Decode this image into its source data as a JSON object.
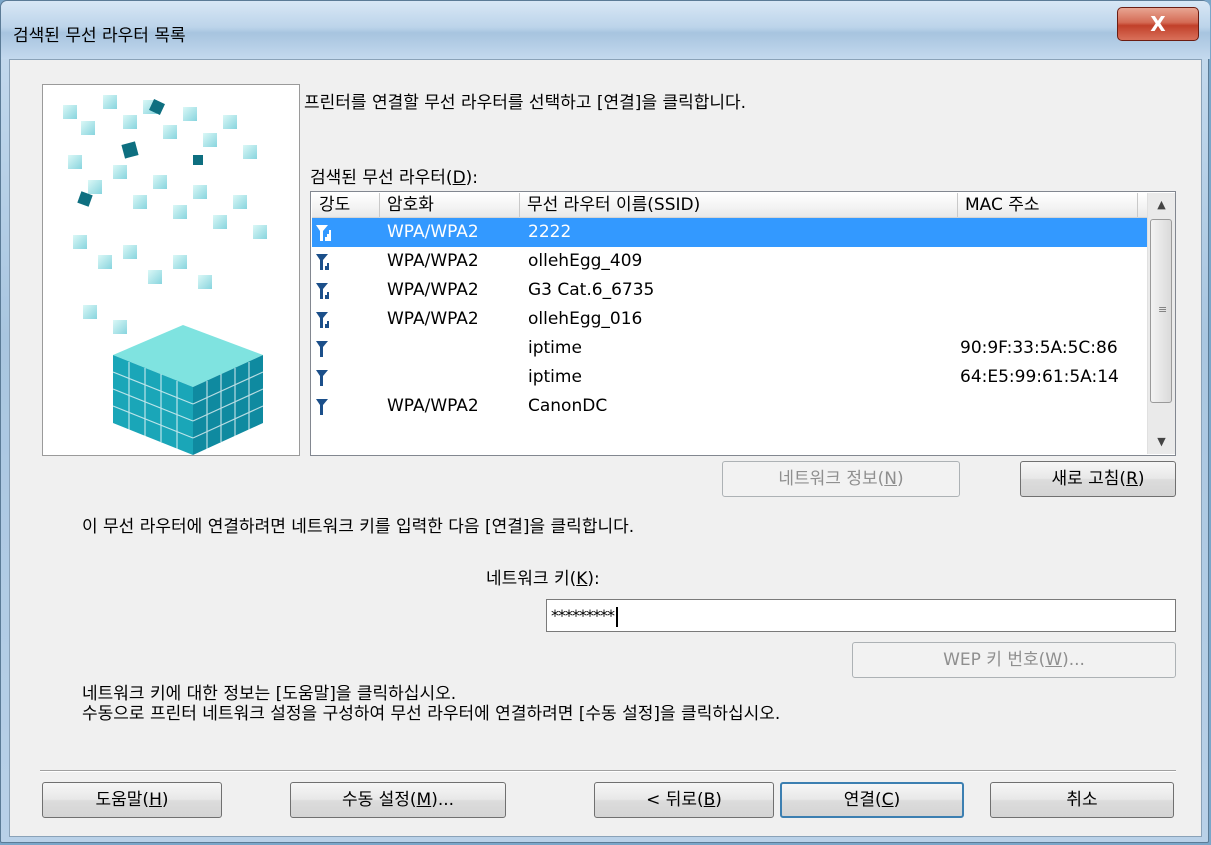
{
  "window": {
    "title": "검색된 무선 라우터 목록",
    "close_label": "X"
  },
  "instruction_select": "프린터를 연결할 무선 라우터를 선택하고 [연결]을 클릭합니다.",
  "router_list": {
    "label_pre": "검색된 무선 라우터(",
    "label_key": "D",
    "label_post": "):",
    "columns": [
      "강도",
      "암호화",
      "무선 라우터 이름(SSID)",
      "MAC 주소"
    ],
    "rows": [
      {
        "strength": 4,
        "encryption": "WPA/WPA2",
        "ssid": "2222",
        "mac": "",
        "selected": true
      },
      {
        "strength": 3,
        "encryption": "WPA/WPA2",
        "ssid": "ollehEgg_409",
        "mac": "",
        "selected": false
      },
      {
        "strength": 3,
        "encryption": "WPA/WPA2",
        "ssid": "G3 Cat.6_6735",
        "mac": "",
        "selected": false
      },
      {
        "strength": 3,
        "encryption": "WPA/WPA2",
        "ssid": "ollehEgg_016",
        "mac": "",
        "selected": false
      },
      {
        "strength": 1,
        "encryption": "",
        "ssid": "iptime",
        "mac": "90:9F:33:5A:5C:86",
        "selected": false
      },
      {
        "strength": 1,
        "encryption": "",
        "ssid": "iptime",
        "mac": "64:E5:99:61:5A:14",
        "selected": false
      },
      {
        "strength": 1,
        "encryption": "WPA/WPA2",
        "ssid": "CanonDC",
        "mac": "",
        "selected": false
      }
    ]
  },
  "network_info_button": {
    "pre": "네트워크 정보(",
    "key": "N",
    "post": ")"
  },
  "refresh_button": {
    "pre": "새로 고침(",
    "key": "R",
    "post": ")"
  },
  "instruction_key": "이 무선 라우터에 연결하려면 네트워크 키를 입력한 다음 [연결]을 클릭합니다.",
  "network_key": {
    "label_pre": "네트워크 키(",
    "label_key": "K",
    "label_post": "):",
    "value": "*********"
  },
  "wep_button": {
    "pre": "WEP 키 번호(",
    "key": "W",
    "post": ")..."
  },
  "help_text_line1": "네트워크 키에 대한 정보는 [도움말]을 클릭하십시오.",
  "help_text_line2": "수동으로 프린터 네트워크 설정을 구성하여 무선 라우터에 연결하려면 [수동 설정]을 클릭하십시오.",
  "footer": {
    "help": {
      "pre": "도움말(",
      "key": "H",
      "post": ")"
    },
    "manual": {
      "pre": "수동 설정(",
      "key": "M",
      "post": ")..."
    },
    "back": {
      "pre": "< 뒤로(",
      "key": "B",
      "post": ")"
    },
    "connect": {
      "pre": "연결(",
      "key": "C",
      "post": ")"
    },
    "cancel": "취소"
  },
  "colors": {
    "selection": "#3399ff",
    "signal_icon": "#1b4f8a",
    "art_cube": "#2ec4c4"
  }
}
